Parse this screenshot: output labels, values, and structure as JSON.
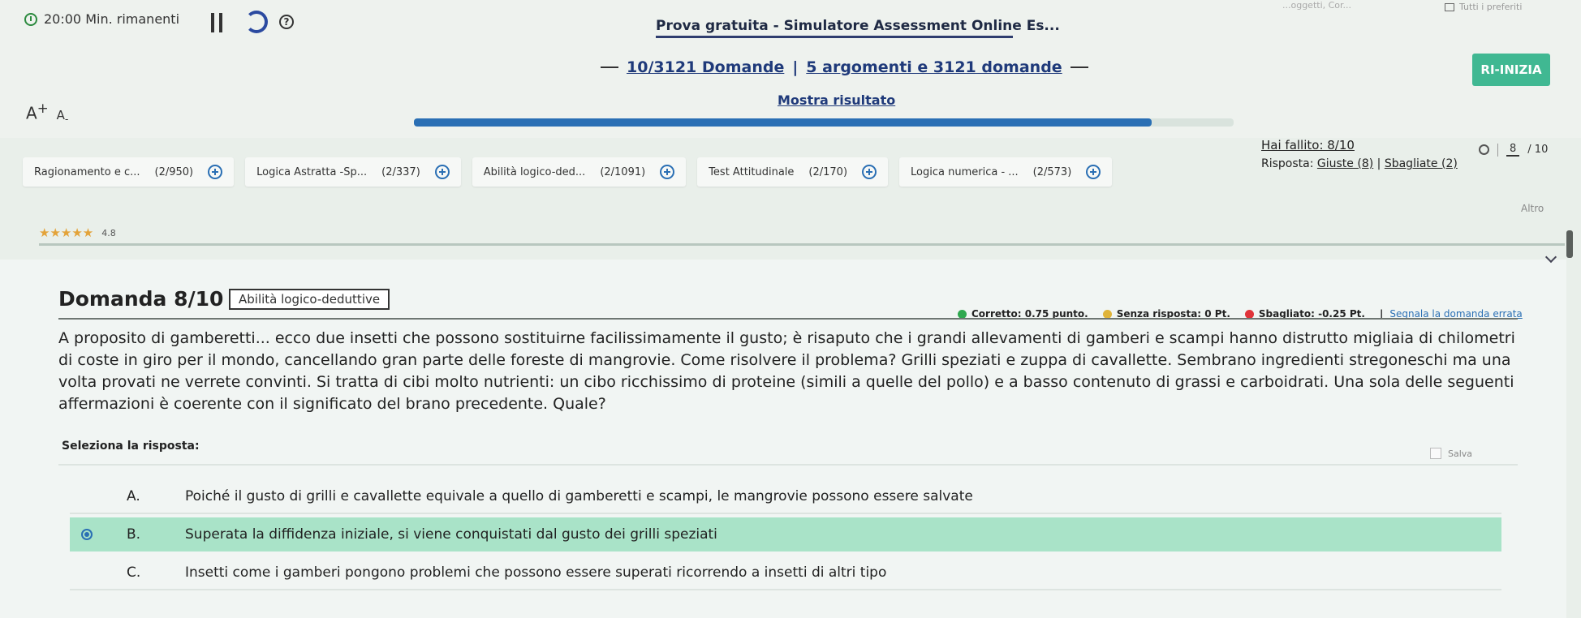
{
  "header": {
    "timer_text": "20:00 Min. rimanenti",
    "exam_title": "Prova gratuita - Simulatore Assessment Online Es...",
    "question_count_link": "10/3121 Domande",
    "topics_link": "5 argomenti e 3121 domande",
    "separator": "|",
    "results_link": "Mostra risultato",
    "restart_label": "RI-INIZIA",
    "font_increase_label": "A",
    "font_decrease_label": "A",
    "browser_tabs_text": "...oggetti, Cor...",
    "favorites_label": "Tutti i preferiti",
    "progress_fraction": 0.9
  },
  "stats": {
    "failed_text": "Hai fallito: 8/10",
    "answer_prefix": "Risposta:",
    "correct_link": "Giuste (8)",
    "wrong_link": "Sbagliate (2)",
    "divider": "|",
    "current_question": "8",
    "total_questions": "/ 10",
    "more_label": "Altro"
  },
  "topics": [
    {
      "label": "Ragionamento e c...",
      "count": "(2/950)"
    },
    {
      "label": "Logica Astratta -Sp...",
      "count": "(2/337)"
    },
    {
      "label": "Abilità logico-ded...",
      "count": "(2/1091)"
    },
    {
      "label": "Test Attitudinale",
      "count": "(2/170)"
    },
    {
      "label": "Logica numerica - ...",
      "count": "(2/573)"
    }
  ],
  "rating": {
    "stars": "★★★★★",
    "value": "4.8"
  },
  "question": {
    "title": "Domanda 8/10",
    "category_tag": "Abilità logico-deduttive",
    "legend": {
      "correct": "Corretto: 0.75 punto.",
      "blank": "Senza risposta: 0 Pt.",
      "wrong": "Sbagliato: -0.25 Pt.",
      "divider": "|",
      "report_link": "Segnala la domanda errata"
    },
    "text": "A proposito di gamberetti... ecco due insetti che possono sostituirne facilissimamente il gusto; è risaputo che i grandi allevamenti di gamberi e scampi hanno distrutto migliaia di chilometri di coste in giro per il mondo, cancellando gran parte delle foreste di mangrovie. Come risolvere il problema? Grilli speziati e zuppa di cavallette. Sembrano ingredienti stregoneschi ma una volta provati ne verrete convinti. Si tratta di cibi molto nutrienti: un cibo ricchissimo di proteine (simili a quelle del pollo) e a basso contenuto di grassi e carboidrati. Una sola delle seguenti affermazioni è coerente con il significato del brano precedente. Quale?",
    "select_label": "Seleziona la risposta:",
    "save_label": "Salva",
    "options": [
      {
        "letter": "A.",
        "text": "Poiché il gusto di grilli e cavallette equivale a quello di gamberetti e scampi, le mangrovie possono essere salvate"
      },
      {
        "letter": "B.",
        "text": "Superata la diffidenza iniziale, si viene conquistati dal gusto dei grilli speziati"
      },
      {
        "letter": "C.",
        "text": "Insetti come i gamberi pongono problemi che possono essere superati ricorrendo a insetti di altri tipo"
      }
    ],
    "selected_option": "B."
  },
  "colors": {
    "accent": "#2a6fb4",
    "restart_bg": "#40b892",
    "selected_bg": "#a9e3c8",
    "correct_dot": "#2fa84f",
    "blank_dot": "#e0b43a",
    "wrong_dot": "#e0343a"
  }
}
